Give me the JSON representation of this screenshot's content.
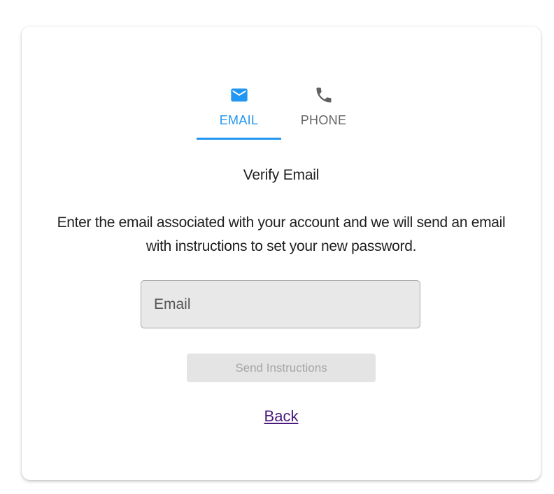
{
  "tabs": [
    {
      "label": "EMAIL",
      "icon": "envelope-icon",
      "active": true,
      "color": "#2196f3"
    },
    {
      "label": "PHONE",
      "icon": "phone-icon",
      "active": false,
      "color": "#666666"
    }
  ],
  "title": "Verify Email",
  "description": "Enter the email associated with your account and we will send an email with instructions to set your new password.",
  "email_field": {
    "placeholder": "Email",
    "value": ""
  },
  "send_button": {
    "label": "Send Instructions",
    "disabled": true
  },
  "back_link": {
    "label": "Back"
  },
  "colors": {
    "accent": "#2196f3",
    "link": "#4b1a7f",
    "disabled_text": "#a6a6a6"
  }
}
